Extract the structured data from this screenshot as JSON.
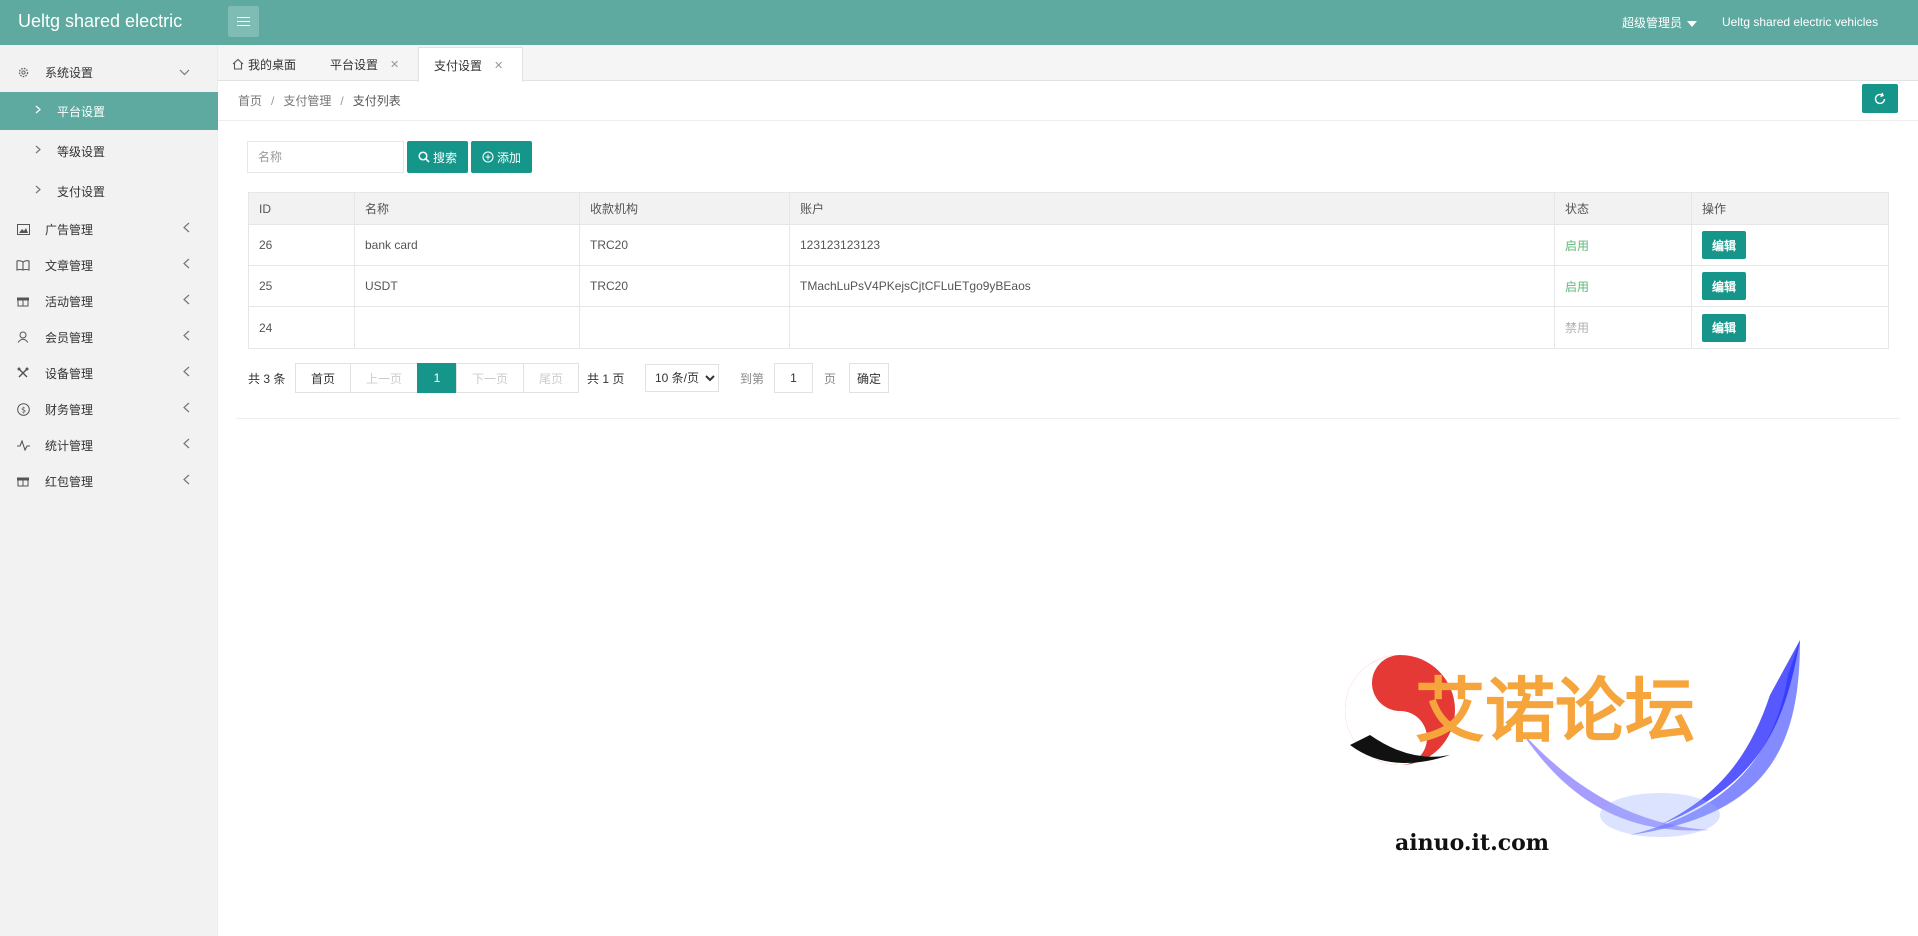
{
  "header": {
    "logo": "Ueltg shared electric",
    "user": "超级管理员",
    "site_name": "Ueltg shared electric vehicles"
  },
  "sidebar": {
    "items": [
      {
        "label": "系统设置",
        "icon": "gear-icon",
        "expanded": true
      },
      {
        "label": "广告管理",
        "icon": "image-icon"
      },
      {
        "label": "文章管理",
        "icon": "book-icon"
      },
      {
        "label": "活动管理",
        "icon": "gift-icon"
      },
      {
        "label": "会员管理",
        "icon": "user-icon"
      },
      {
        "label": "设备管理",
        "icon": "tools-icon"
      },
      {
        "label": "财务管理",
        "icon": "dollar-icon"
      },
      {
        "label": "统计管理",
        "icon": "pulse-icon"
      },
      {
        "label": "红包管理",
        "icon": "gift-icon"
      }
    ],
    "sub_items": [
      {
        "label": "平台设置",
        "active": true
      },
      {
        "label": "等级设置"
      },
      {
        "label": "支付设置"
      }
    ]
  },
  "tabs": [
    {
      "label": "我的桌面",
      "icon": "home-icon"
    },
    {
      "label": "平台设置",
      "closable": true
    },
    {
      "label": "支付设置",
      "closable": true,
      "active": true
    }
  ],
  "breadcrumb": [
    "首页",
    "支付管理",
    "支付列表"
  ],
  "search": {
    "placeholder": "名称",
    "search_label": "搜索",
    "add_label": "添加"
  },
  "table": {
    "headers": [
      "ID",
      "名称",
      "收款机构",
      "账户",
      "状态",
      "操作"
    ],
    "rows": [
      {
        "id": "26",
        "name": "bank card",
        "org": "TRC20",
        "account": "123123123123",
        "status": "启用",
        "action": "编辑"
      },
      {
        "id": "25",
        "name": "USDT",
        "org": "TRC20",
        "account": "TMachLuPsV4PKejsCjtCFLuETgo9yBEaos",
        "status": "启用",
        "action": "编辑"
      },
      {
        "id": "24",
        "name": "",
        "org": "",
        "account": "",
        "status": "禁用",
        "action": "编辑"
      }
    ]
  },
  "pagination": {
    "total_text": "共 3 条",
    "first": "首页",
    "prev": "上一页",
    "current": "1",
    "next": "下一页",
    "last": "尾页",
    "pages_text": "共 1 页",
    "page_size": "10 条/页",
    "goto_label": "到第",
    "goto_value": "1",
    "page_unit": "页",
    "confirm": "确定"
  },
  "watermark": {
    "title": "艾诺论坛",
    "url": "ainuo.it.com"
  },
  "colors": {
    "header": "#5ea9a0",
    "accent": "#16968a",
    "status_on": "#5fb878",
    "status_off": "#b0b0b0"
  }
}
